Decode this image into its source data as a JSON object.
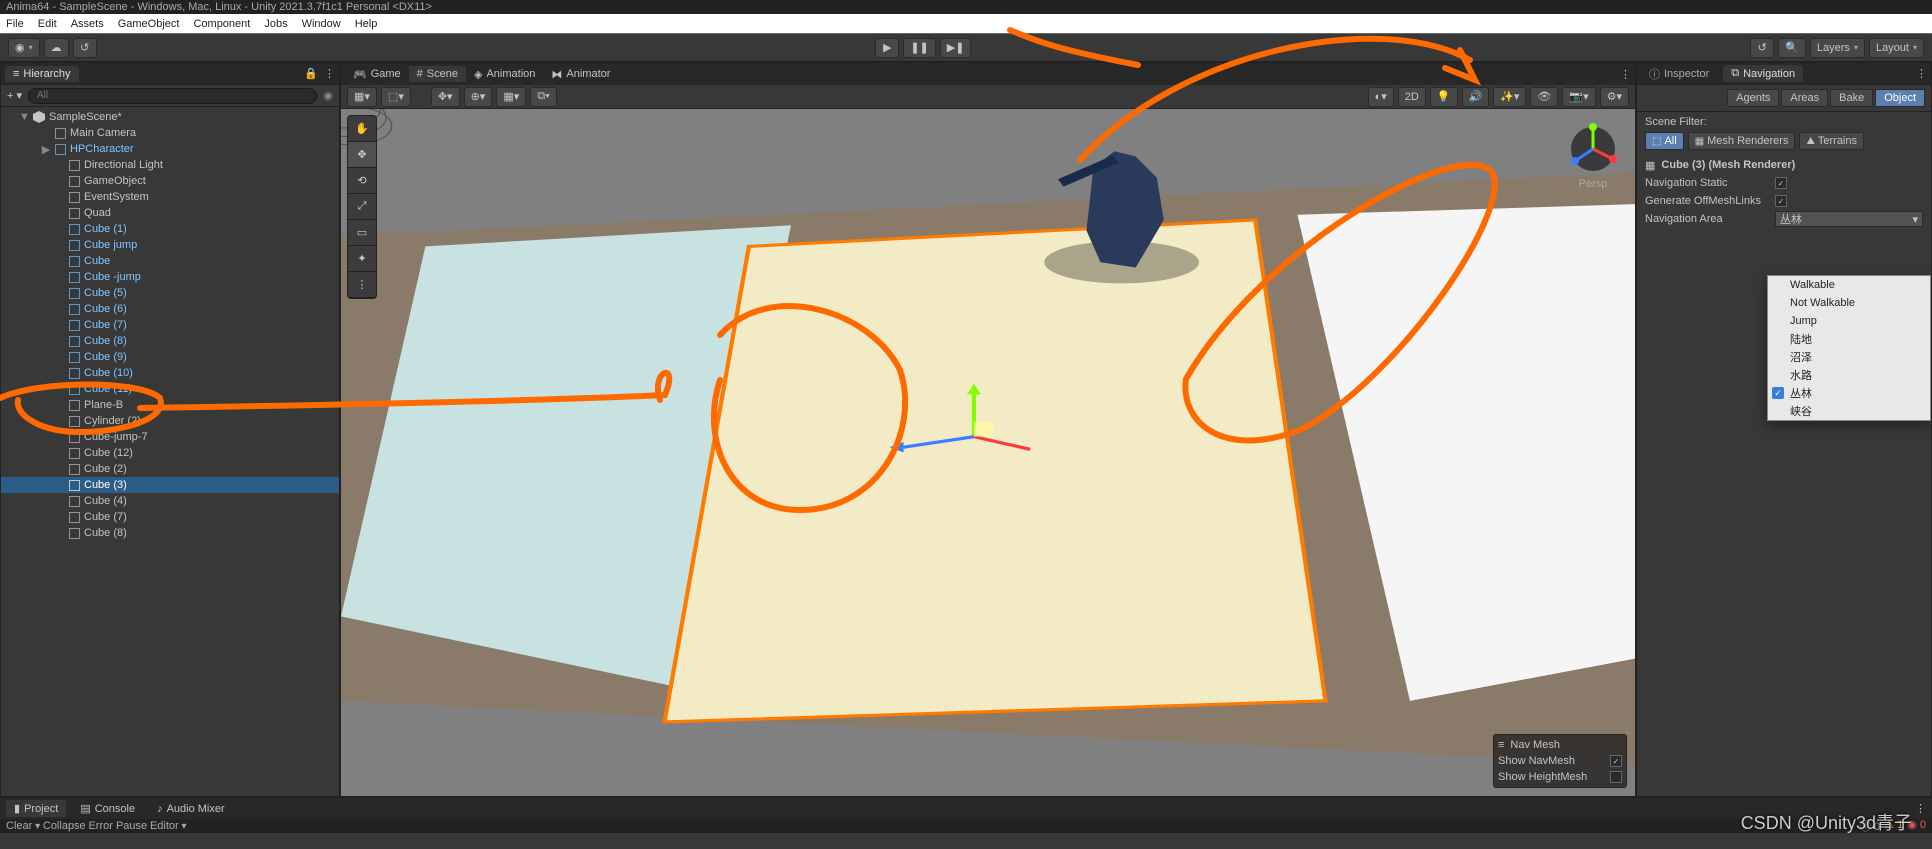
{
  "titlebar": "Anima64 - SampleScene - Windows, Mac, Linux - Unity 2021.3.7f1c1 Personal  <DX11>",
  "menu": {
    "file": "File",
    "edit": "Edit",
    "assets": "Assets",
    "gameobject": "GameObject",
    "component": "Component",
    "jobs": "Jobs",
    "window": "Window",
    "help": "Help"
  },
  "toolbar": {
    "layers": "Layers",
    "layout": "Layout"
  },
  "hierarchy": {
    "title": "Hierarchy",
    "search_placeholder": "All",
    "scene": "SampleScene*",
    "items": [
      {
        "label": "Main Camera",
        "indent": 40
      },
      {
        "label": "HPCharacter",
        "indent": 40,
        "blue": true,
        "arrow": "▶"
      },
      {
        "label": "Directional Light",
        "indent": 54
      },
      {
        "label": "GameObject",
        "indent": 54
      },
      {
        "label": "EventSystem",
        "indent": 54
      },
      {
        "label": "Quad",
        "indent": 54
      },
      {
        "label": "Cube (1)",
        "indent": 54,
        "blue": true
      },
      {
        "label": "Cube jump",
        "indent": 54,
        "blue": true
      },
      {
        "label": "Cube",
        "indent": 54,
        "blue": true
      },
      {
        "label": "Cube -jump",
        "indent": 54,
        "blue": true
      },
      {
        "label": "Cube (5)",
        "indent": 54,
        "blue": true
      },
      {
        "label": "Cube (6)",
        "indent": 54,
        "blue": true
      },
      {
        "label": "Cube (7)",
        "indent": 54,
        "blue": true
      },
      {
        "label": "Cube (8)",
        "indent": 54,
        "blue": true
      },
      {
        "label": "Cube (9)",
        "indent": 54,
        "blue": true
      },
      {
        "label": "Cube (10)",
        "indent": 54,
        "blue": true
      },
      {
        "label": "Cube (11)",
        "indent": 54,
        "blue": true
      },
      {
        "label": "Plane-B",
        "indent": 54
      },
      {
        "label": "Cylinder (2)",
        "indent": 54
      },
      {
        "label": "Cube-jump-7",
        "indent": 54
      },
      {
        "label": "Cube (12)",
        "indent": 54
      },
      {
        "label": "Cube (2)",
        "indent": 54
      },
      {
        "label": "Cube (3)",
        "indent": 54,
        "selected": true
      },
      {
        "label": "Cube (4)",
        "indent": 54
      },
      {
        "label": "Cube (7)",
        "indent": 54
      },
      {
        "label": "Cube (8)",
        "indent": 54
      }
    ]
  },
  "viewport": {
    "tabs": {
      "game": "Game",
      "scene": "Scene",
      "animation": "Animation",
      "animator": "Animator"
    },
    "persp": "Persp",
    "btn2d": "2D",
    "navmesh": {
      "title": "Nav Mesh",
      "show_navmesh": "Show NavMesh",
      "show_hm": "Show HeightMesh"
    }
  },
  "inspector": {
    "tabs": {
      "inspector": "Inspector",
      "navigation": "Navigation"
    },
    "nav_tabs": {
      "agents": "Agents",
      "areas": "Areas",
      "bake": "Bake",
      "object": "Object"
    },
    "scene_filter_label": "Scene Filter:",
    "filters": {
      "all": "All",
      "mesh": "Mesh Renderers",
      "terrain": "Terrains"
    },
    "header": "Cube (3) (Mesh Renderer)",
    "props": {
      "nav_static": {
        "label": "Navigation Static",
        "checked": true
      },
      "gen_links": {
        "label": "Generate OffMeshLinks",
        "checked": true
      },
      "nav_area": {
        "label": "Navigation Area",
        "value": "丛林"
      }
    },
    "dropdown": [
      {
        "label": "Walkable"
      },
      {
        "label": "Not Walkable"
      },
      {
        "label": "Jump"
      },
      {
        "label": "陆地"
      },
      {
        "label": "沼泽"
      },
      {
        "label": "水路"
      },
      {
        "label": "丛林",
        "checked": true
      },
      {
        "label": "峡谷"
      }
    ]
  },
  "bottom": {
    "project": "Project",
    "console": "Console",
    "audio": "Audio Mixer"
  },
  "status": {
    "clear": "Clear",
    "collapse": "Collapse",
    "error_pause": "Error Pause",
    "editor": "Editor"
  },
  "watermark": "CSDN @Unity3d青子"
}
